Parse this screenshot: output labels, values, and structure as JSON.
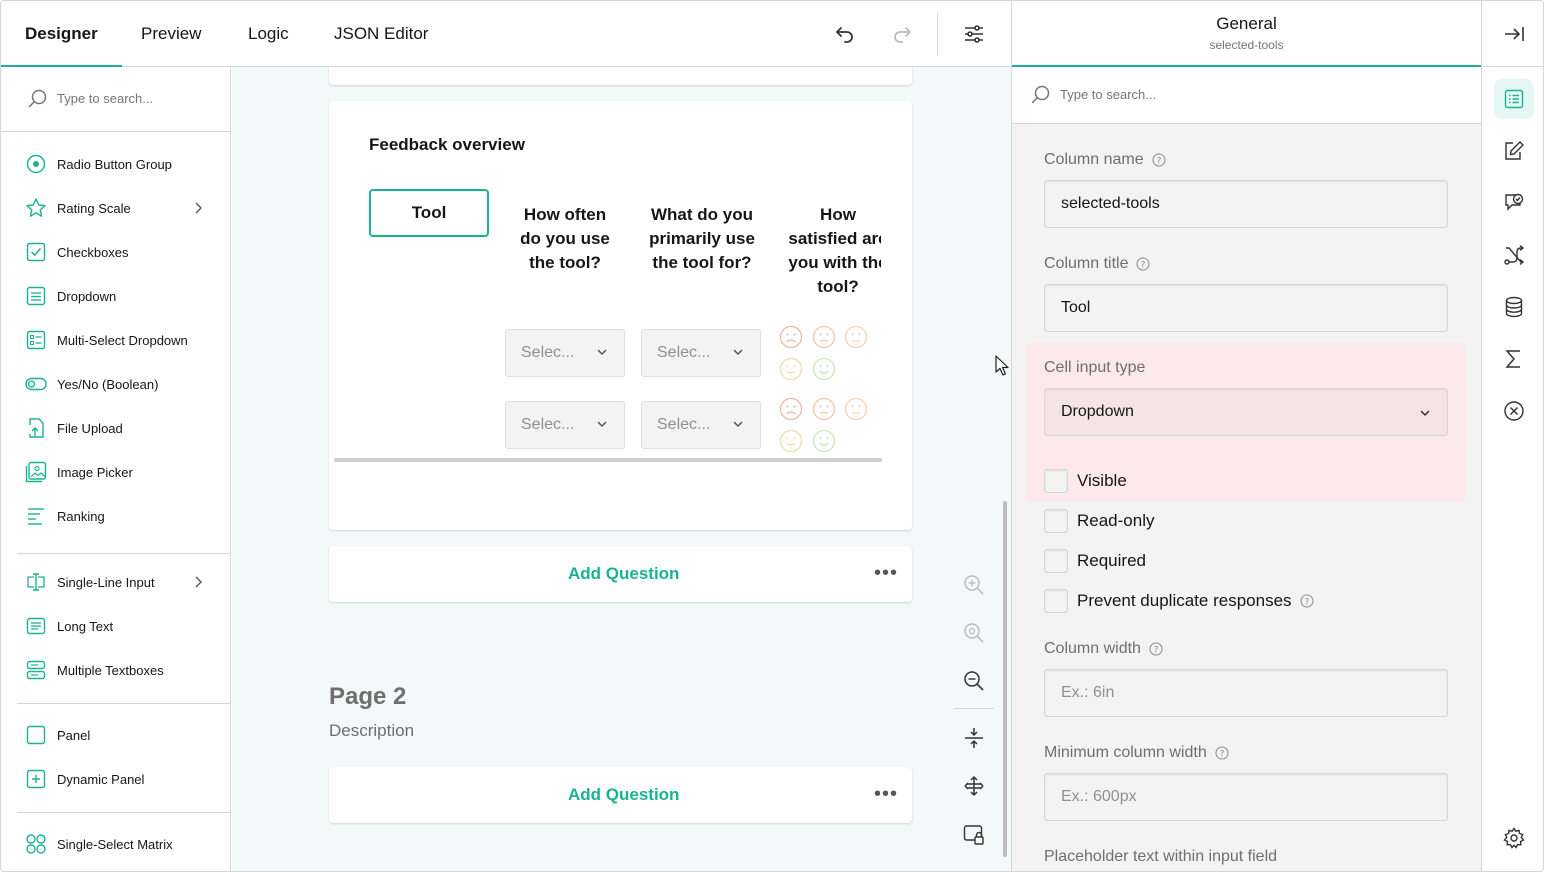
{
  "header": {
    "tabs": [
      {
        "label": "Designer",
        "active": true
      },
      {
        "label": "Preview",
        "active": false
      },
      {
        "label": "Logic",
        "active": false
      },
      {
        "label": "JSON Editor",
        "active": false
      }
    ],
    "actions": [
      "undo-icon",
      "redo-icon",
      "settings-sliders-icon"
    ]
  },
  "toolbox": {
    "search_placeholder": "Type to search...",
    "items": [
      {
        "label": "Radio Button Group",
        "icon": "radio-icon"
      },
      {
        "label": "Rating Scale",
        "icon": "star-icon",
        "has_submenu": true
      },
      {
        "label": "Checkboxes",
        "icon": "checkbox-icon"
      },
      {
        "label": "Dropdown",
        "icon": "dropdown-icon"
      },
      {
        "label": "Multi-Select Dropdown",
        "icon": "tagbox-icon"
      },
      {
        "label": "Yes/No (Boolean)",
        "icon": "toggle-icon"
      },
      {
        "label": "File Upload",
        "icon": "file-upload-icon"
      },
      {
        "label": "Image Picker",
        "icon": "image-icon"
      },
      {
        "label": "Ranking",
        "icon": "ranking-icon"
      },
      {
        "label": "Single-Line Input",
        "icon": "text-input-icon",
        "has_submenu": true
      },
      {
        "label": "Long Text",
        "icon": "comment-icon"
      },
      {
        "label": "Multiple Textboxes",
        "icon": "multiple-text-icon"
      },
      {
        "label": "Panel",
        "icon": "panel-icon"
      },
      {
        "label": "Dynamic Panel",
        "icon": "dynamic-panel-icon"
      },
      {
        "label": "Single-Select Matrix",
        "icon": "matrix-icon"
      }
    ]
  },
  "canvas": {
    "matrix": {
      "title": "Feedback overview",
      "columns": [
        {
          "lines": [
            "Tool"
          ]
        },
        {
          "lines": [
            "How often",
            "do you use",
            "the tool?"
          ]
        },
        {
          "lines": [
            "What do you",
            "primarily use",
            "the tool for?"
          ]
        },
        {
          "lines": [
            "How",
            "satisfied are",
            "you with the",
            "tool?"
          ]
        }
      ],
      "rows": [
        {
          "cells": [
            "Selec...",
            "Selec..."
          ]
        },
        {
          "cells": [
            "Selec...",
            "Selec..."
          ]
        }
      ]
    },
    "add_question_label": "Add Question",
    "more_label": "•••",
    "page2": {
      "title": "Page 2",
      "description": "Description",
      "add_question_label": "Add Question"
    },
    "zoom_tools": [
      "zoom-in-icon",
      "zoom-reset-icon",
      "zoom-out-icon",
      "collapse-icon",
      "expand-icon",
      "lock-icon"
    ]
  },
  "properties": {
    "category": "General",
    "object_name": "selected-tools",
    "search_placeholder": "Type to search...",
    "column_name_label": "Column name",
    "column_name_value": "selected-tools",
    "column_title_label": "Column title",
    "column_title_value": "Tool",
    "cell_input_type_label": "Cell input type",
    "cell_input_type_value": "Dropdown",
    "checkboxes": [
      {
        "label": "Visible",
        "checked": false
      },
      {
        "label": "Read-only",
        "checked": false
      },
      {
        "label": "Required",
        "checked": false
      },
      {
        "label": "Prevent duplicate responses",
        "checked": false,
        "help": true
      }
    ],
    "column_width_label": "Column width",
    "column_width_placeholder": "Ex.: 6in",
    "min_width_label": "Minimum column width",
    "min_width_placeholder": "Ex.: 600px",
    "placeholder_label": "Placeholder text within input field"
  },
  "sidebar": {
    "icons": [
      "collapse-panel-icon",
      "general-icon",
      "edit-icon",
      "choices-icon",
      "logic-icon",
      "data-icon",
      "totals-icon",
      "validation-icon",
      "settings-icon"
    ]
  },
  "colors": {
    "accent": "#19b394",
    "highlight": "#fbe9eb"
  }
}
